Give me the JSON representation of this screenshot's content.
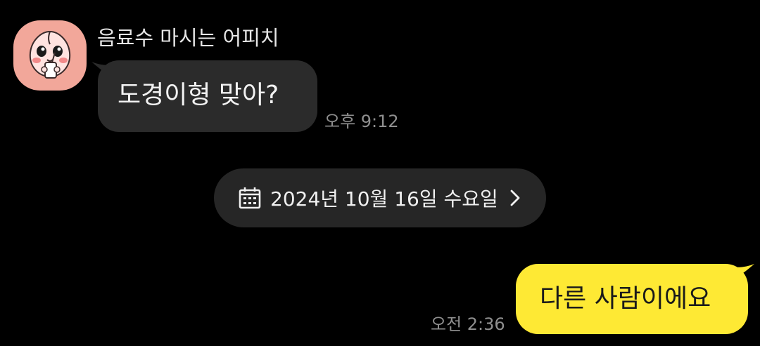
{
  "incoming": {
    "sender_name": "음료수 마시는 어피치",
    "message": "도경이형 맞아?",
    "time": "오후 9:12",
    "avatar_icon": "apeach-drinking-avatar"
  },
  "date_divider": {
    "label": "2024년 10월 16일 수요일",
    "icon": "calendar-icon",
    "chevron": "chevron-right-icon"
  },
  "outgoing": {
    "message": "다른 사람이에요",
    "time": "오전 2:36"
  },
  "colors": {
    "background": "#000000",
    "incoming_bubble": "#2b2b2b",
    "outgoing_bubble": "#fee934",
    "date_pill": "#262626",
    "timestamp": "#8f8f8f",
    "avatar_bg": "#f2a79a"
  }
}
